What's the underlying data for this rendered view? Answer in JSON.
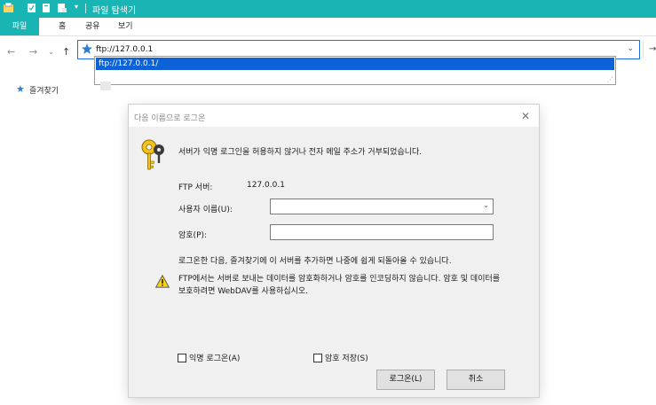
{
  "window": {
    "title": "파일 탐색기"
  },
  "ribbon": {
    "tabs": [
      "파일",
      "홈",
      "공유",
      "보기"
    ]
  },
  "address": {
    "value": "ftp://127.0.0.1",
    "suggestion": "ftp://127.0.0.1/"
  },
  "nav_pane": {
    "favorites_label": "즐겨찾기"
  },
  "dialog": {
    "title": "다음 이름으로 로그온",
    "message": "서버가 익명 로그인을 허용하지 않거나 전자 메일 주소가 거부되었습니다.",
    "server_label": "FTP 서버:",
    "server_value": "127.0.0.1",
    "username_label": "사용자 이름(U):",
    "username_value": "",
    "password_label": "암호(P):",
    "password_value": "",
    "save_note": "로그온한 다음, 즐겨찾기에 이 서버를 추가하면 나중에 쉽게 되돌아올 수 있습니다.",
    "warning_text": "FTP에서는 서버로 보내는 데이터를 암호화하거나 암호를 인코딩하지 않습니다. 암호 및 데이터를 보호하려면 WebDAV를 사용하십시오.",
    "anonymous_label": "익명 로그온(A)",
    "save_password_label": "암호 저장(S)",
    "login_button": "로그온(L)",
    "cancel_button": "취소"
  },
  "colors": {
    "accent": "#19b5b5",
    "selection": "#0c62d6",
    "dialog_bg": "#f0f0f0"
  }
}
